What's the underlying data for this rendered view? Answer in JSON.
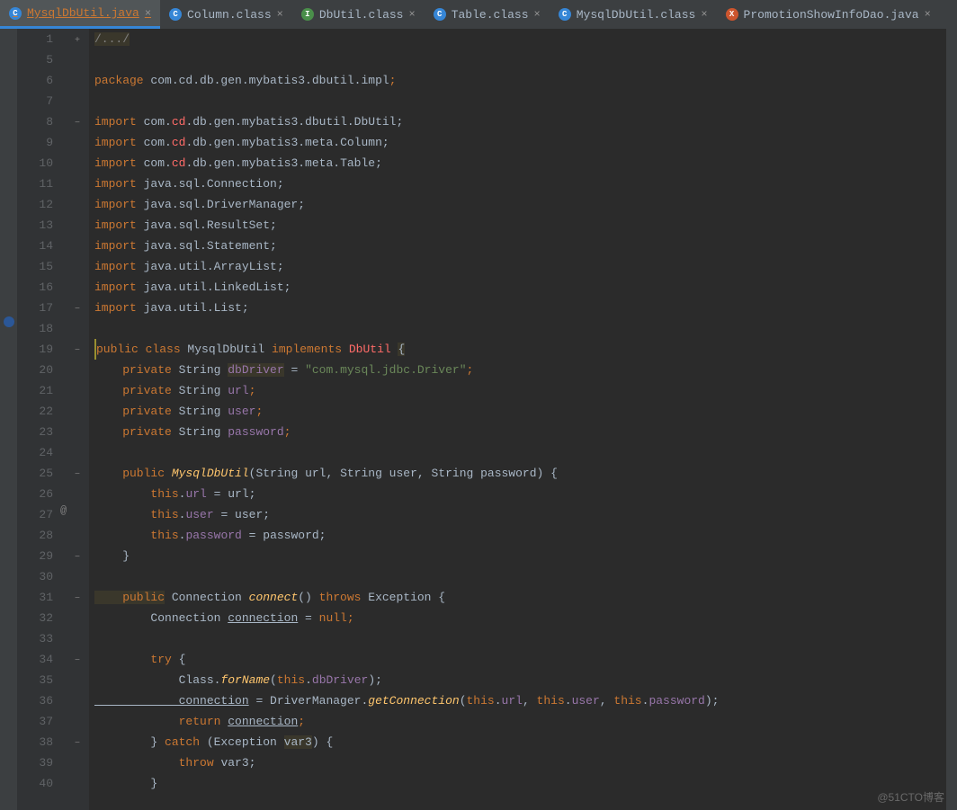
{
  "tabs": [
    {
      "label": "MysqlDbUtil.java",
      "icon": "c",
      "active": true
    },
    {
      "label": "Column.class",
      "icon": "c",
      "active": false
    },
    {
      "label": "DbUtil.class",
      "icon": "i",
      "active": false
    },
    {
      "label": "Table.class",
      "icon": "c",
      "active": false
    },
    {
      "label": "MysqlDbUtil.class",
      "icon": "c",
      "active": false
    },
    {
      "label": "PromotionShowInfoDao.java",
      "icon": "x",
      "active": false
    }
  ],
  "icon_letters": {
    "c": "C",
    "i": "I",
    "x": "X"
  },
  "line_numbers": [
    "1",
    "5",
    "6",
    "7",
    "8",
    "9",
    "10",
    "11",
    "12",
    "13",
    "14",
    "15",
    "16",
    "17",
    "18",
    "19",
    "20",
    "21",
    "22",
    "23",
    "24",
    "25",
    "26",
    "27",
    "28",
    "29",
    "30",
    "31",
    "32",
    "33",
    "34",
    "35",
    "36",
    "37",
    "38",
    "39",
    "40"
  ],
  "ann_at": "@",
  "fold_closed": "+",
  "fold_open": "−",
  "code": {
    "l1": "/.../",
    "l6a": "package ",
    "l6b": "com.cd.db.gen.mybatis3.dbutil.impl",
    "l6c": ";",
    "l8a": "import ",
    "l8b": "com.",
    "l8c": "cd",
    "l8d": ".db.gen.mybatis3.dbutil.DbUtil;",
    "l9a": "import ",
    "l9b": "com.",
    "l9c": "cd",
    "l9d": ".db.gen.mybatis3.meta.Column;",
    "l10a": "import ",
    "l10b": "com.",
    "l10c": "cd",
    "l10d": ".db.gen.mybatis3.meta.Table;",
    "l11a": "import ",
    "l11b": "java.sql.Connection;",
    "l12a": "import ",
    "l12b": "java.sql.DriverManager;",
    "l13a": "import ",
    "l13b": "java.sql.ResultSet;",
    "l14a": "import ",
    "l14b": "java.sql.Statement;",
    "l15a": "import ",
    "l15b": "java.util.ArrayList;",
    "l16a": "import ",
    "l16b": "java.util.LinkedList;",
    "l17a": "import ",
    "l17b": "java.util.List;",
    "l19a": "public class ",
    "l19b": "MysqlDbUtil ",
    "l19c": "implements ",
    "l19d": "DbUtil ",
    "l19e": "{",
    "l20a": "    private ",
    "l20b": "String ",
    "l20c": "dbDriver",
    "l20d": " = ",
    "l20e": "\"com.mysql.jdbc.Driver\"",
    "l20f": ";",
    "l21a": "    private ",
    "l21b": "String ",
    "l21c": "url",
    "l21d": ";",
    "l22a": "    private ",
    "l22b": "String ",
    "l22c": "user",
    "l22d": ";",
    "l23a": "    private ",
    "l23b": "String ",
    "l23c": "password",
    "l23d": ";",
    "l25a": "    public ",
    "l25b": "MysqlDbUtil",
    "l25c": "(String url, String user, String password) {",
    "l26a": "        this",
    "l26b": ".",
    "l26c": "url",
    "l26d": " = url;",
    "l27a": "        this",
    "l27b": ".",
    "l27c": "user",
    "l27d": " = user;",
    "l28a": "        this",
    "l28b": ".",
    "l28c": "password",
    "l28d": " = password;",
    "l29": "    }",
    "l31a": "    public",
    "l31b": " Connection ",
    "l31c": "connect",
    "l31d": "() ",
    "l31e": "throws ",
    "l31f": "Exception {",
    "l32a": "        Connection ",
    "l32b": "connection",
    "l32c": " = ",
    "l32d": "null",
    "l32e": ";",
    "l34a": "        try ",
    "l34b": "{",
    "l35a": "            Class.",
    "l35b": "forName",
    "l35c": "(",
    "l35d": "this",
    "l35e": ".",
    "l35f": "dbDriver",
    "l35g": ");",
    "l36a": "            connection",
    "l36b": " = DriverManager.",
    "l36c": "getConnection",
    "l36d": "(",
    "l36e": "this",
    "l36f": ".",
    "l36g": "url",
    "l36h": ", ",
    "l36i": "this",
    "l36j": ".",
    "l36k": "user",
    "l36l": ", ",
    "l36m": "this",
    "l36n": ".",
    "l36o": "password",
    "l36p": ");",
    "l37a": "            return ",
    "l37b": "connection",
    "l37c": ";",
    "l38a": "        } ",
    "l38b": "catch ",
    "l38c": "(Exception ",
    "l38d": "var3",
    "l38e": ") {",
    "l39a": "            throw ",
    "l39b": "var3;",
    "l40": "        }"
  },
  "watermark": "@51CTO博客"
}
